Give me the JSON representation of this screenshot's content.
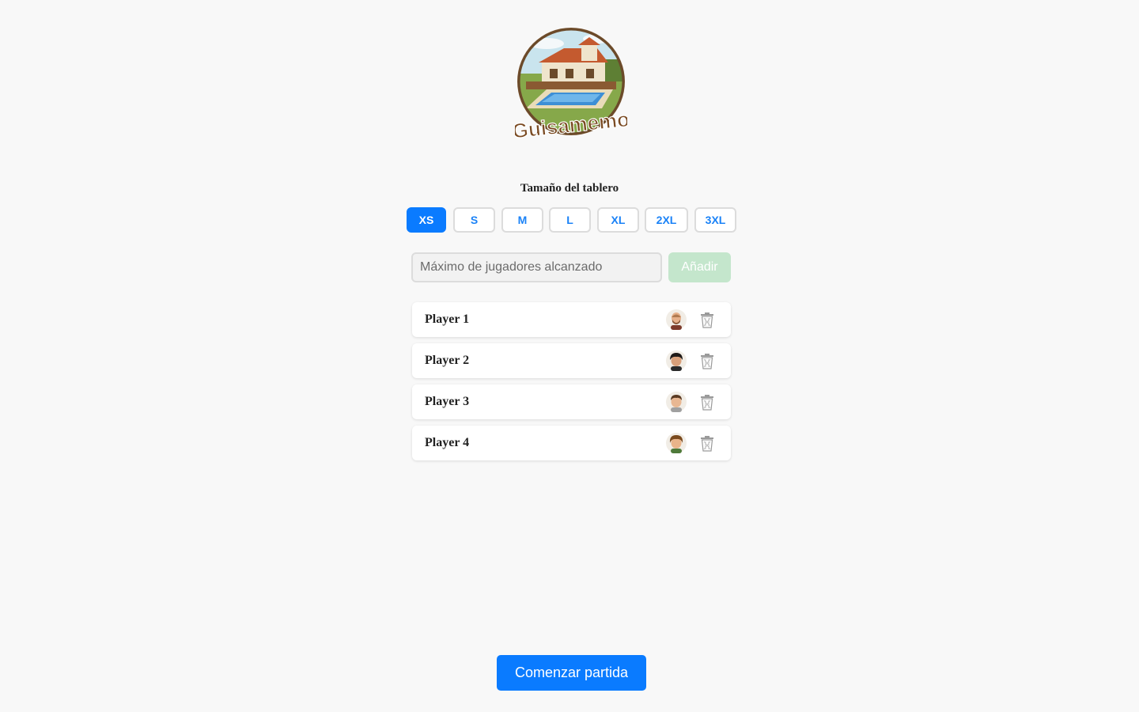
{
  "logo": {
    "text": "Guisamemo"
  },
  "board": {
    "title": "Tamaño del tablero",
    "sizes": [
      {
        "label": "XS",
        "active": true
      },
      {
        "label": "S",
        "active": false
      },
      {
        "label": "M",
        "active": false
      },
      {
        "label": "L",
        "active": false
      },
      {
        "label": "XL",
        "active": false
      },
      {
        "label": "2XL",
        "active": false
      },
      {
        "label": "3XL",
        "active": false
      }
    ]
  },
  "player_input": {
    "placeholder": "Máximo de jugadores alcanzado",
    "value": "",
    "disabled": true
  },
  "add_button": {
    "label": "Añadir",
    "disabled": true
  },
  "players": [
    {
      "name": "Player 1",
      "avatar": "avatar-bald-man-icon"
    },
    {
      "name": "Player 2",
      "avatar": "avatar-dark-hair-boy-icon"
    },
    {
      "name": "Player 3",
      "avatar": "avatar-brown-hair-boy-icon"
    },
    {
      "name": "Player 4",
      "avatar": "avatar-brown-hair-man-icon"
    }
  ],
  "start_button": {
    "label": "Comenzar partida"
  },
  "colors": {
    "primary": "#0a7bff",
    "add_disabled": "#c4e6cc",
    "background": "#f8f8f8"
  }
}
